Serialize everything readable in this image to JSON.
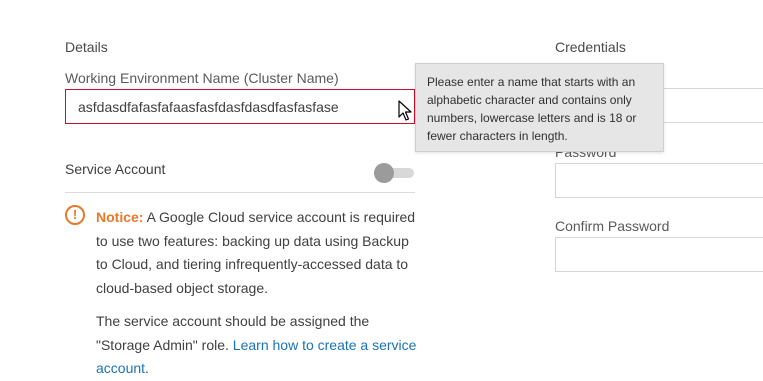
{
  "details": {
    "section_title": "Details",
    "working_env_label": "Working Environment Name (Cluster Name)",
    "working_env_value": "asfdasdfafasfafaasfasfdasfdasdfasfasfase",
    "service_account_label": "Service Account",
    "service_account_toggle": false
  },
  "tooltip": {
    "text": "Please enter a name that starts with an alphabetic character and contains only numbers, lowercase letters and is 18 or fewer characters in length."
  },
  "notice": {
    "icon": "exclamation-circle-icon",
    "title": "Notice:",
    "body": " A Google Cloud service account is required to use two features: backing up data using Backup to Cloud, and tiering infrequently-accessed data to cloud-based object storage.",
    "para2": "The service account should be assigned the \"Storage Admin\" role. ",
    "link": "Learn how to create a service account",
    "para2_end": "."
  },
  "credentials": {
    "section_title": "Credentials",
    "password_label": "Password",
    "confirm_password_label": "Confirm Password"
  },
  "colors": {
    "error_border": "#c8102e",
    "notice_accent": "#e8782a",
    "link": "#1a73b8",
    "tooltip_bg": "#e6e6e6"
  }
}
